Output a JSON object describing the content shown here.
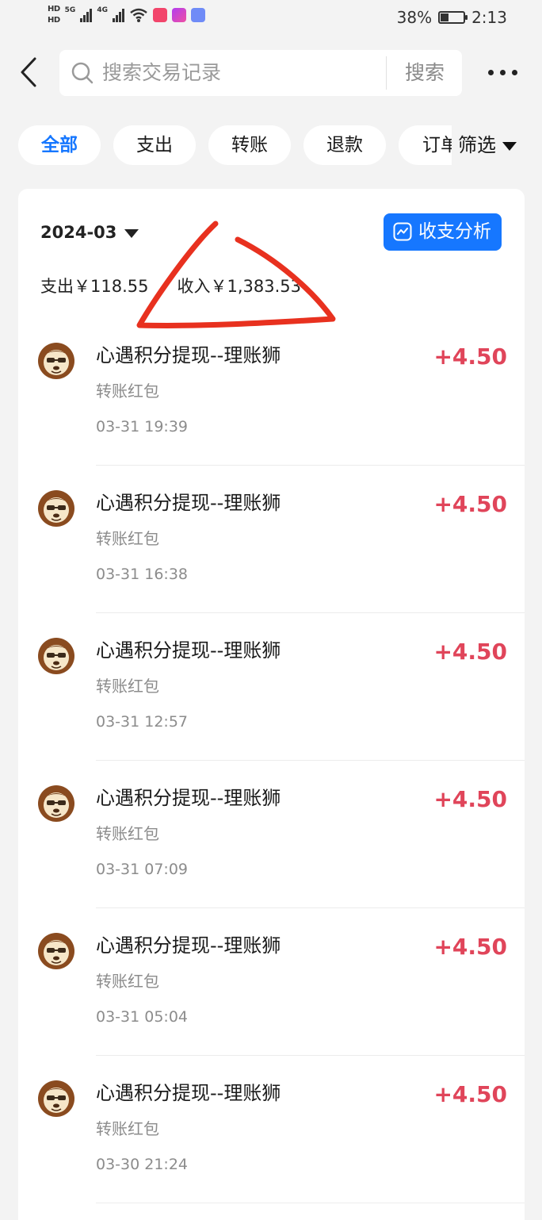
{
  "status_bar": {
    "hd1": "HD",
    "hd2": "HD",
    "net": "5G",
    "net2": "4G",
    "battery": "38%",
    "battery_level": 0.38,
    "time": "2:13"
  },
  "header": {
    "search_placeholder": "搜索交易记录",
    "search_button": "搜索"
  },
  "filters": {
    "chips": [
      "全部",
      "支出",
      "转账",
      "退款",
      "订单"
    ],
    "active": "全部",
    "filter_label": "筛选"
  },
  "summary": {
    "month": "2024-03",
    "expense": "支出￥118.55",
    "income": "收入￥1,383.53",
    "analysis_button": "收支分析"
  },
  "transactions": [
    {
      "title": "心遇积分提现--理账狮",
      "subtitle": "转账红包",
      "time": "03-31 19:39",
      "amount": "+4.50"
    },
    {
      "title": "心遇积分提现--理账狮",
      "subtitle": "转账红包",
      "time": "03-31 16:38",
      "amount": "+4.50"
    },
    {
      "title": "心遇积分提现--理账狮",
      "subtitle": "转账红包",
      "time": "03-31 12:57",
      "amount": "+4.50"
    },
    {
      "title": "心遇积分提现--理账狮",
      "subtitle": "转账红包",
      "time": "03-31 07:09",
      "amount": "+4.50"
    },
    {
      "title": "心遇积分提现--理账狮",
      "subtitle": "转账红包",
      "time": "03-31 05:04",
      "amount": "+4.50"
    },
    {
      "title": "心遇积分提现--理账狮",
      "subtitle": "转账红包",
      "time": "03-30 21:24",
      "amount": "+4.50"
    }
  ],
  "colors": {
    "accent": "#1677ff",
    "income": "#e0455a",
    "annotation": "#e8311f"
  }
}
